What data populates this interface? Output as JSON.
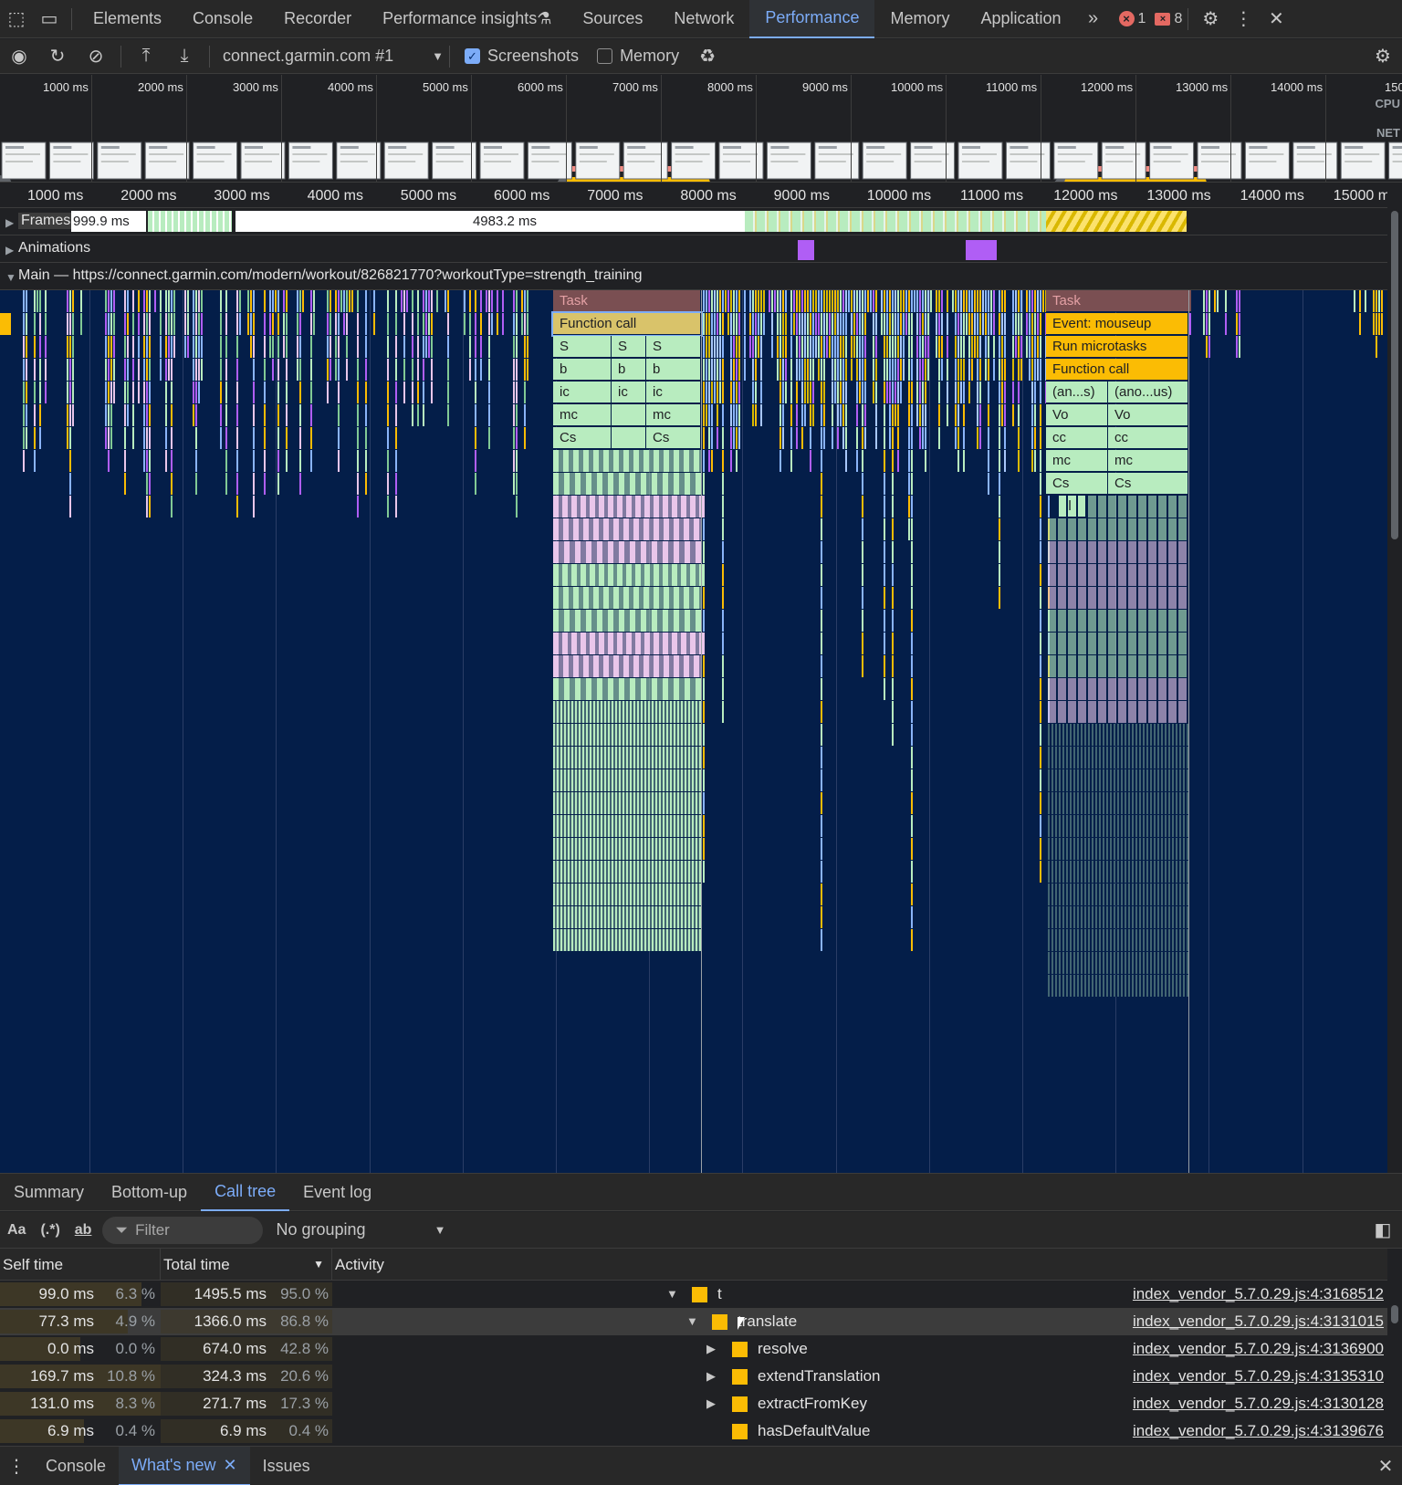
{
  "tabs": [
    {
      "label": "Elements",
      "name": "tab-elements",
      "active": false
    },
    {
      "label": "Console",
      "name": "tab-console",
      "active": false
    },
    {
      "label": "Recorder",
      "name": "tab-recorder",
      "active": false
    },
    {
      "label": "Performance insights",
      "name": "tab-performance-insights",
      "active": false
    },
    {
      "label": "Sources",
      "name": "tab-sources",
      "active": false
    },
    {
      "label": "Network",
      "name": "tab-network",
      "active": false
    },
    {
      "label": "Performance",
      "name": "tab-performance",
      "active": true
    },
    {
      "label": "Memory",
      "name": "tab-memory",
      "active": false
    },
    {
      "label": "Application",
      "name": "tab-application",
      "active": false
    }
  ],
  "status": {
    "errors": "1",
    "warnings": "8"
  },
  "toolbar": {
    "recording_target": "connect.garmin.com #1",
    "screenshots_label": "Screenshots",
    "screenshots_checked": true,
    "memory_label": "Memory",
    "memory_checked": false
  },
  "overview": {
    "ticks": [
      "1000 ms",
      "2000 ms",
      "3000 ms",
      "4000 ms",
      "5000 ms",
      "6000 ms",
      "7000 ms",
      "8000 ms",
      "9000 ms",
      "10000 ms",
      "11000 ms",
      "12000 ms",
      "13000 ms",
      "14000 ms",
      "15000"
    ],
    "cpu_label": "CPU",
    "net_label": "NET"
  },
  "ruler": {
    "ticks": [
      "1000 ms",
      "2000 ms",
      "3000 ms",
      "4000 ms",
      "5000 ms",
      "6000 ms",
      "7000 ms",
      "8000 ms",
      "9000 ms",
      "10000 ms",
      "11000 ms",
      "12000 ms",
      "13000 ms",
      "14000 ms",
      "15000 m"
    ]
  },
  "tracks": {
    "frames_label": "Frames",
    "frames_time_1": "999.9 ms",
    "frames_time_2": "4983.2 ms",
    "animations_label": "Animations",
    "main_label": "Main — https://connect.garmin.com/modern/workout/826821770?workoutType=strength_training"
  },
  "flame": {
    "left_block": [
      {
        "text": "Task",
        "row": 0,
        "cols": [
          "Task"
        ]
      },
      {
        "text": "Function call"
      },
      {
        "cols": [
          "S",
          "S",
          "S"
        ]
      },
      {
        "cols": [
          "b",
          "b",
          "b"
        ]
      },
      {
        "cols": [
          "ic",
          "ic",
          "ic"
        ]
      },
      {
        "cols": [
          "mc",
          "",
          "mc"
        ]
      },
      {
        "cols": [
          "Cs",
          "",
          "Cs"
        ]
      }
    ],
    "right_block": [
      {
        "text": "Task"
      },
      {
        "text": "Event: mouseup"
      },
      {
        "text": "Run microtasks"
      },
      {
        "text": "Function call"
      },
      {
        "cols": [
          "(an...s)",
          "(ano...us)"
        ]
      },
      {
        "cols": [
          "Vo",
          "Vo"
        ]
      },
      {
        "cols": [
          "cc",
          "cc"
        ]
      },
      {
        "cols": [
          "mc",
          "mc"
        ]
      },
      {
        "cols": [
          "Cs",
          "Cs"
        ]
      },
      {
        "cols": [
          "ll"
        ]
      }
    ]
  },
  "bottom_tabs": [
    {
      "label": "Summary",
      "name": "tab-summary",
      "active": false
    },
    {
      "label": "Bottom-up",
      "name": "tab-bottom-up",
      "active": false
    },
    {
      "label": "Call tree",
      "name": "tab-call-tree",
      "active": true
    },
    {
      "label": "Event log",
      "name": "tab-event-log",
      "active": false
    }
  ],
  "filter": {
    "match_case": "Aa",
    "regex": "(.*)",
    "whole_word": "ab",
    "placeholder": "Filter",
    "grouping": "No grouping"
  },
  "table": {
    "headers": {
      "self": "Self time",
      "total": "Total time",
      "activity": "Activity"
    },
    "rows": [
      {
        "self_ms": "99.0 ms",
        "self_pct": "6.3 %",
        "self_frac": 0.063,
        "total_ms": "1495.5 ms",
        "total_pct": "95.0 %",
        "indent": 0,
        "expander": "▼",
        "name": "t",
        "source": "index_vendor_5.7.0.29.js:4:3168512",
        "selected": false
      },
      {
        "self_ms": "77.3 ms",
        "self_pct": "4.9 %",
        "self_frac": 0.049,
        "total_ms": "1366.0 ms",
        "total_pct": "86.8 %",
        "indent": 1,
        "expander": "▼",
        "name": "translate",
        "source": "index_vendor_5.7.0.29.js:4:3131015",
        "selected": true
      },
      {
        "self_ms": "0.0 ms",
        "self_pct": "0.0 %",
        "self_frac": 0.0,
        "total_ms": "674.0 ms",
        "total_pct": "42.8 %",
        "indent": 2,
        "expander": "▶",
        "name": "resolve",
        "source": "index_vendor_5.7.0.29.js:4:3136900",
        "selected": false
      },
      {
        "self_ms": "169.7 ms",
        "self_pct": "10.8 %",
        "self_frac": 0.108,
        "total_ms": "324.3 ms",
        "total_pct": "20.6 %",
        "indent": 2,
        "expander": "▶",
        "name": "extendTranslation",
        "source": "index_vendor_5.7.0.29.js:4:3135310",
        "selected": false
      },
      {
        "self_ms": "131.0 ms",
        "self_pct": "8.3 %",
        "self_frac": 0.083,
        "total_ms": "271.7 ms",
        "total_pct": "17.3 %",
        "indent": 2,
        "expander": "▶",
        "name": "extractFromKey",
        "source": "index_vendor_5.7.0.29.js:4:3130128",
        "selected": false
      },
      {
        "self_ms": "6.9 ms",
        "self_pct": "0.4 %",
        "self_frac": 0.004,
        "total_ms": "6.9 ms",
        "total_pct": "0.4 %",
        "indent": 2,
        "expander": "",
        "name": "hasDefaultValue",
        "source": "index_vendor_5.7.0.29.js:4:3139676",
        "selected": false
      }
    ]
  },
  "drawer_tabs": [
    {
      "label": "Console",
      "name": "drawer-tab-console",
      "active": false
    },
    {
      "label": "What's new",
      "name": "drawer-tab-whats-new",
      "active": true
    },
    {
      "label": "Issues",
      "name": "drawer-tab-issues",
      "active": false
    }
  ],
  "colors": {
    "accent": "#7cacf8",
    "scripting": "#fbbc04",
    "task": "#7a4f52",
    "green": "#b8ecbf",
    "pink": "#e9c6ea",
    "purple": "#b05ef5",
    "flame_bg": "#041e49"
  }
}
